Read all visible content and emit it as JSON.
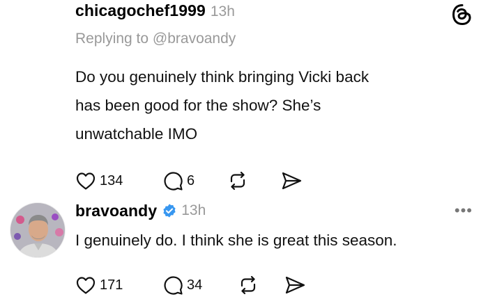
{
  "post": {
    "username": "chicagochef1999",
    "time": "13h",
    "replying_to": "Replying to @bravoandy",
    "text_lines": [
      "Do you genuinely think bringing Vicki back",
      "has been good for the show? She’s",
      "unwatchable IMO"
    ],
    "likes": "134",
    "comments": "6"
  },
  "reply": {
    "username": "bravoandy",
    "time": "13h",
    "text": "I genuinely do. I think she is great this season.",
    "likes": "171",
    "comments": "34",
    "more": "•••"
  },
  "icons": {
    "logo": "threads-logo-icon",
    "like": "heart-icon",
    "comment": "comment-bubble-icon",
    "repost": "repost-icon",
    "share": "send-icon",
    "verified": "verified-badge-icon"
  },
  "colors": {
    "verified_blue": "#3897f0",
    "muted_text": "#999999"
  }
}
